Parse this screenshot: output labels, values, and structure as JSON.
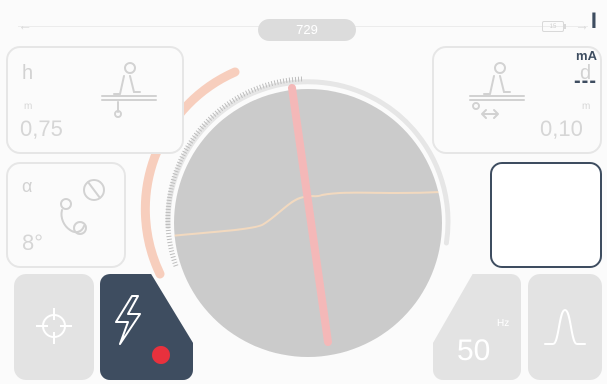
{
  "header": {
    "counter": "729",
    "battery_level": "15",
    "back_arrow": "←",
    "forward_arrow": "→"
  },
  "panels": {
    "depth": {
      "label": "h",
      "unit": "m",
      "value": "0,75"
    },
    "distance": {
      "label": "d",
      "unit": "m",
      "value": "0,10"
    },
    "angle": {
      "label": "α",
      "value": "8°"
    },
    "current": {
      "label": "I",
      "unit": "mA",
      "value": "---"
    }
  },
  "buttons": {
    "frequency": {
      "unit": "Hz",
      "value": "50"
    }
  },
  "colors": {
    "accent": "#3e4d60",
    "record": "#e8313d",
    "needle": "#f4b8b8",
    "trace": "#f2d9bf",
    "gauge_warm": "#f6c9b6",
    "display": "#cbcbcb"
  },
  "icons": {
    "back": "arrow-left-icon",
    "forward": "arrow-right-icon",
    "battery": "battery-icon",
    "depth": "depth-icon",
    "distance": "distance-icon",
    "angle": "angle-icon",
    "locate": "crosshair-icon",
    "signal": "lightning-icon",
    "pulse": "pulse-curve-icon"
  }
}
